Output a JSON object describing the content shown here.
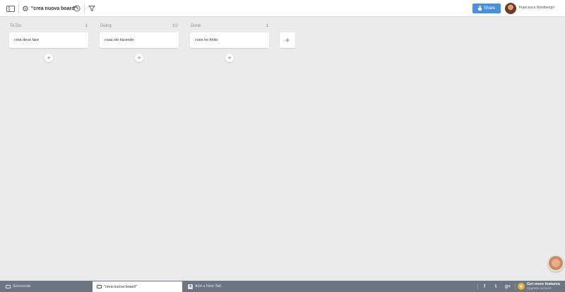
{
  "topbar": {
    "board_title": "\"crea nuova board\"",
    "share_label": "Share",
    "user_name": "Francesca Woolbergel"
  },
  "lists": [
    {
      "title": "To Do",
      "count": "1",
      "cards": [
        "crea devo fare"
      ]
    },
    {
      "title": "Doing",
      "count": "1/2",
      "cards": [
        "cosa sto facendo"
      ]
    },
    {
      "title": "Done",
      "count": "1",
      "cards": [
        "cose ho finito"
      ]
    }
  ],
  "bottombar": {
    "left_label": "Sorrounds",
    "active_tab": "\"crea nuova board\"",
    "new_tab": "Add a New Tab",
    "social": [
      "f",
      "t",
      "g+"
    ],
    "features_title": "Get more features",
    "features_sub": "Upgrade account"
  },
  "colors": {
    "accent": "#4a90d9",
    "board_bg": "#ebebeb",
    "bottombar": "#6c7580",
    "badge": "#e9b13a"
  },
  "icons": {
    "app": "mini-board-icon",
    "settings": "gear-icon",
    "history": "clock-icon",
    "filter": "funnel-icon"
  }
}
